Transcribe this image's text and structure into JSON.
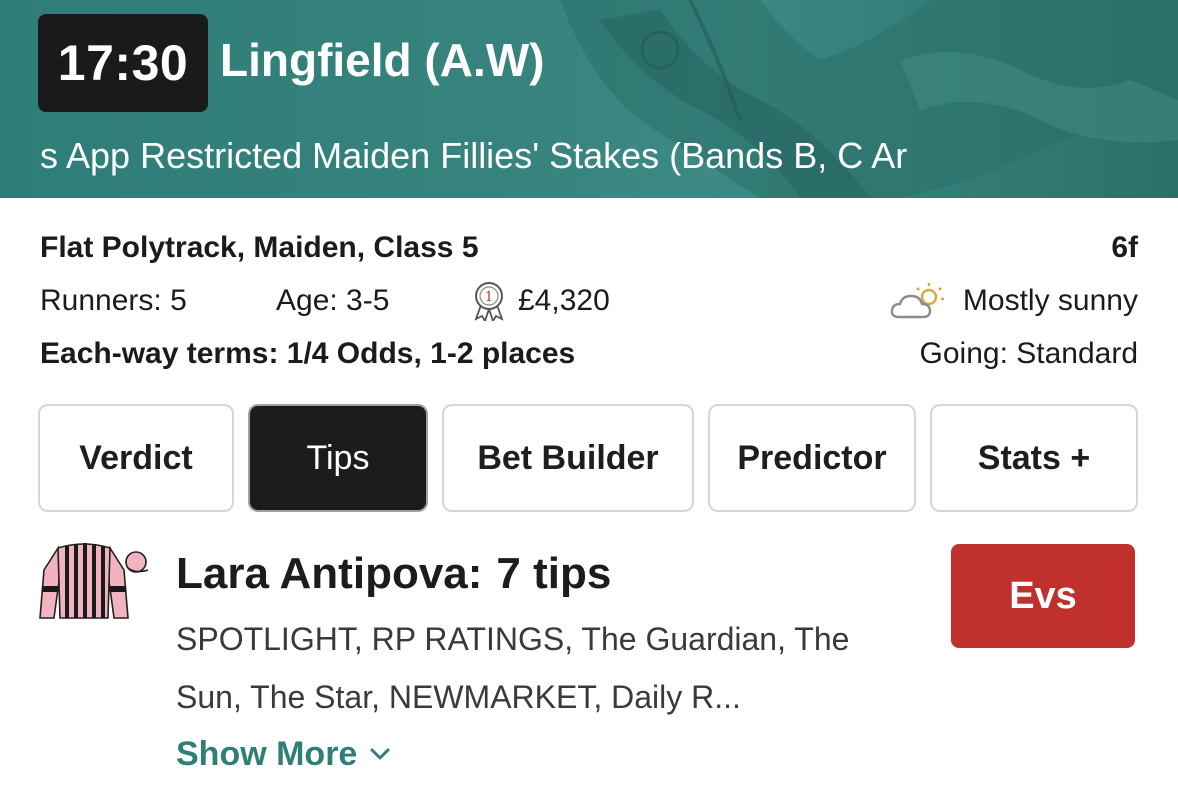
{
  "header": {
    "time": "17:30",
    "course": "Lingfield (A.W)",
    "race_title": "s App Restricted Maiden Fillies' Stakes (Bands B, C Ar"
  },
  "race_info": {
    "type": "Flat Polytrack, Maiden, Class 5",
    "distance": "6f",
    "runners": "Runners: 5",
    "age": "Age: 3-5",
    "prize": "£4,320",
    "weather": "Mostly sunny",
    "each_way": "Each-way terms: 1/4 Odds, 1-2 places",
    "going": "Going: Standard"
  },
  "tabs": [
    {
      "label": "Verdict",
      "active": false
    },
    {
      "label": "Tips",
      "active": true
    },
    {
      "label": "Bet Builder",
      "active": false
    },
    {
      "label": "Predictor",
      "active": false
    },
    {
      "label": "Stats +",
      "active": false
    }
  ],
  "tip": {
    "horse": "Lara Antipova:",
    "tips_count": "7 tips",
    "tipsters": "SPOTLIGHT, RP RATINGS, The Guardian, The Sun, The Star, NEWMARKET, Daily R...",
    "show_more": "Show More",
    "odds": "Evs"
  },
  "icons": {
    "prize": "rosette-icon",
    "weather": "partly-sunny-icon",
    "silks": "jockey-silks-icon",
    "show_more": "chevron-down-icon"
  },
  "colors": {
    "banner": "#37837e",
    "accent": "#2e7f77",
    "odds": "#c0312d",
    "active_tab": "#1c1c1c"
  }
}
